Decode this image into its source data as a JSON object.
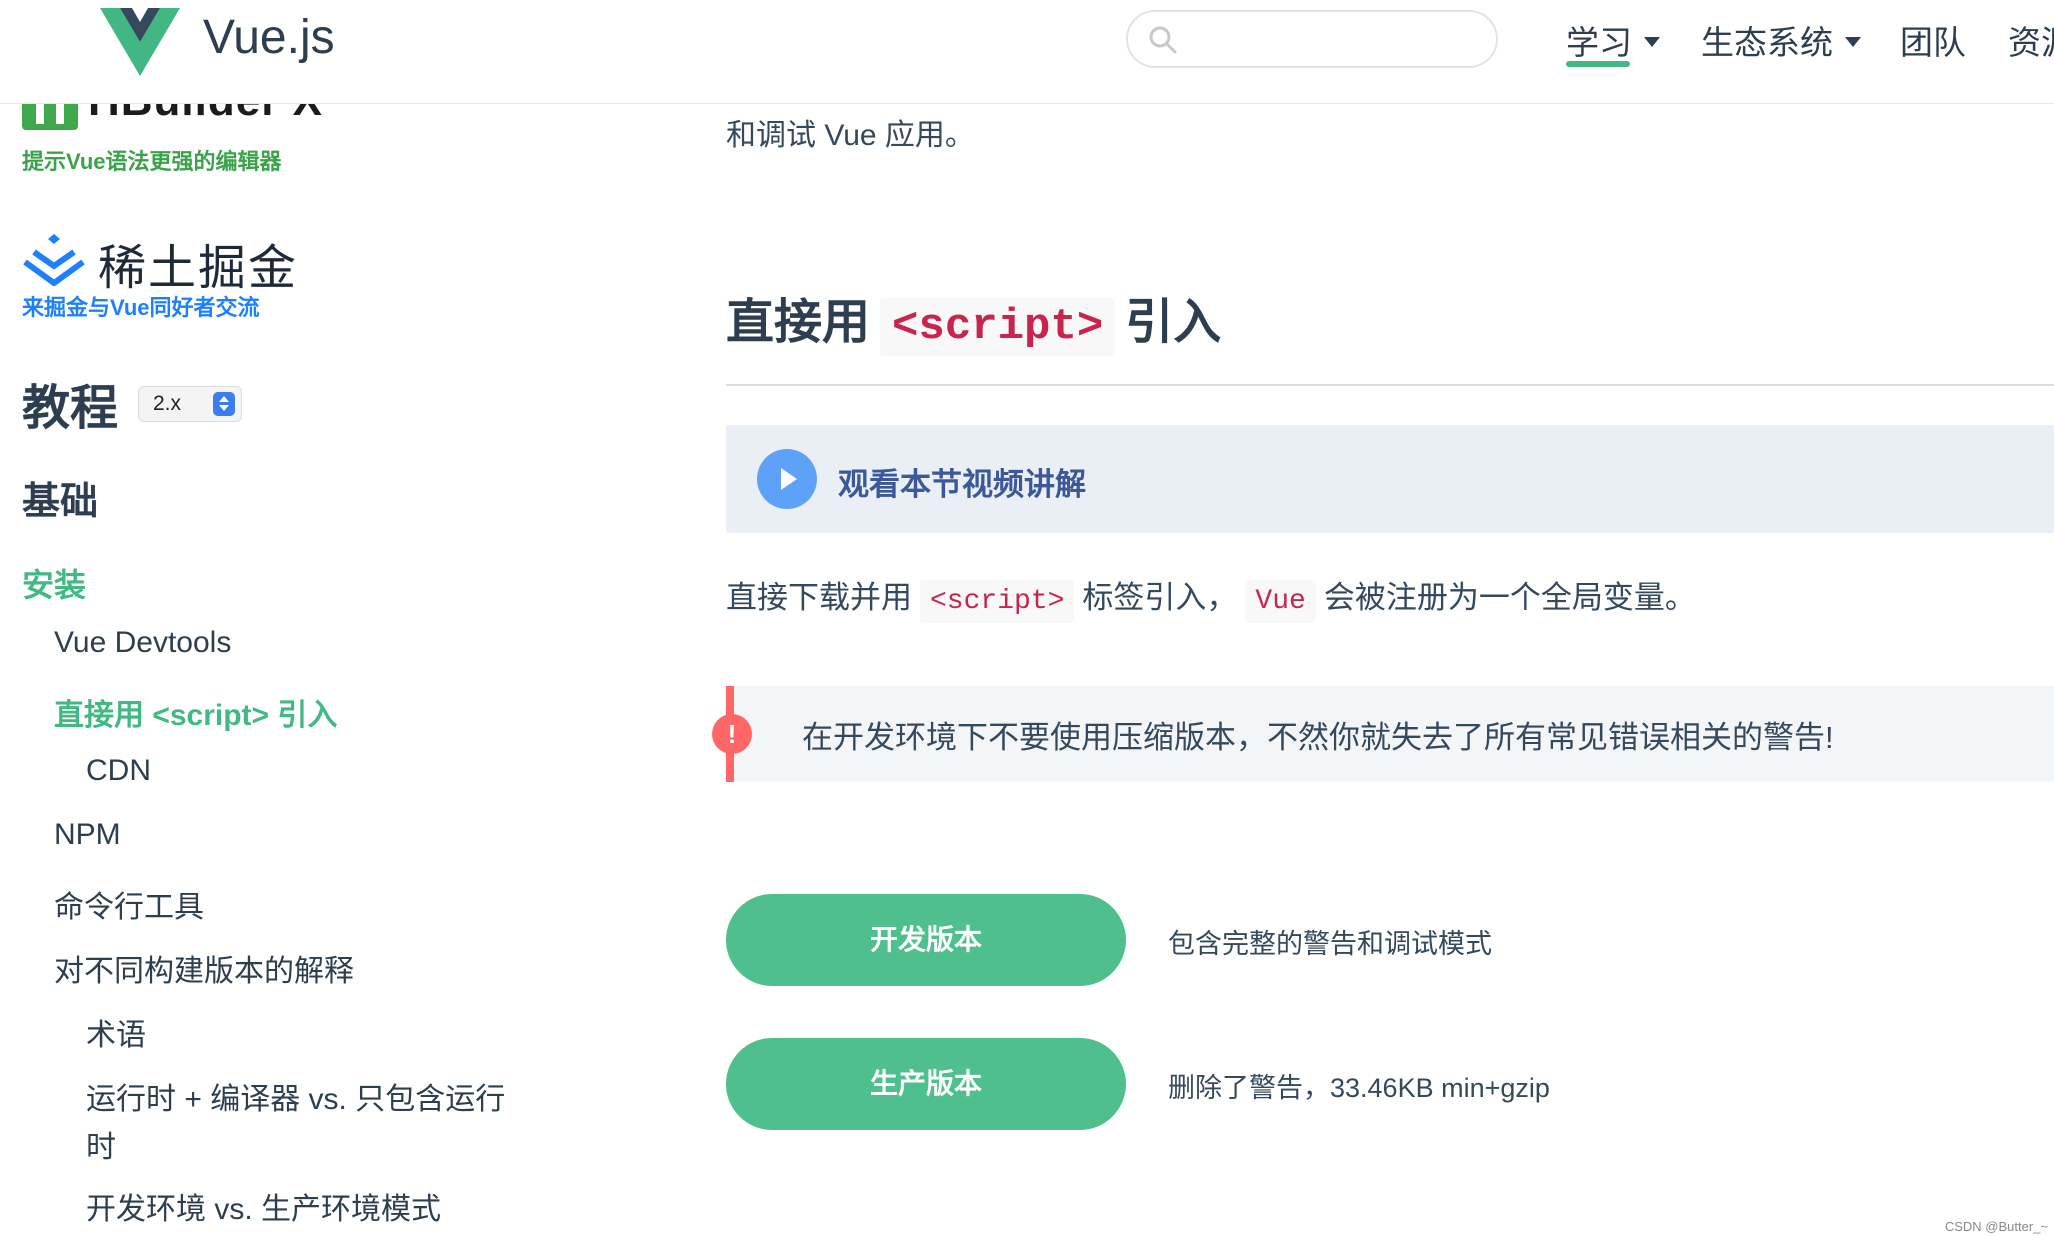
{
  "header": {
    "logo_text": "Vue.js",
    "search": {
      "placeholder": ""
    },
    "nav": [
      {
        "label": "学习",
        "dropdown": true,
        "active": true
      },
      {
        "label": "生态系统",
        "dropdown": true
      },
      {
        "label": "团队"
      },
      {
        "label": "资源"
      }
    ]
  },
  "sidebar": {
    "sponsors": [
      {
        "name": "HBuilder X",
        "tagline": "提示Vue语法更强的编辑器"
      },
      {
        "name": "稀土掘金",
        "tagline": "来掘金与Vue同好者交流"
      }
    ],
    "tutorial_title": "教程",
    "version": "2.x",
    "section": "基础",
    "menu": {
      "install": "安装",
      "devtools": "Vue Devtools",
      "direct_script": "直接用 <script> 引入",
      "cdn": "CDN",
      "npm": "NPM",
      "cli": "命令行工具",
      "builds": "对不同构建版本的解释",
      "terms": "术语",
      "runtime_line1": "运行时 + 编译器 vs. 只包含运行",
      "runtime_line2": "时",
      "dev_prod": "开发环境 vs. 生产环境模式"
    }
  },
  "main": {
    "intro_tail": "和调试 Vue 应用。",
    "heading": {
      "before": "直接用",
      "code": "<script>",
      "after": "引入"
    },
    "video_link": "观看本节视频讲解",
    "paragraph": {
      "p1": "直接下载并用",
      "code1": "<script>",
      "p2": "标签引入，",
      "code2": "Vue",
      "p3": "会被注册为一个全局变量。"
    },
    "tip": {
      "icon": "!",
      "text": "在开发环境下不要使用压缩版本，不然你就失去了所有常见错误相关的警告!"
    },
    "downloads": [
      {
        "label": "开发版本",
        "description": "包含完整的警告和调试模式"
      },
      {
        "label": "生产版本",
        "description": "删除了警告，33.46KB min+gzip"
      }
    ]
  },
  "watermark": "CSDN @Butter_~",
  "colors": {
    "accent": "#42b983",
    "button": "#4fc08d",
    "warning": "#ff6666",
    "code": "#c7254e",
    "video_bg": "#eaeef5"
  }
}
